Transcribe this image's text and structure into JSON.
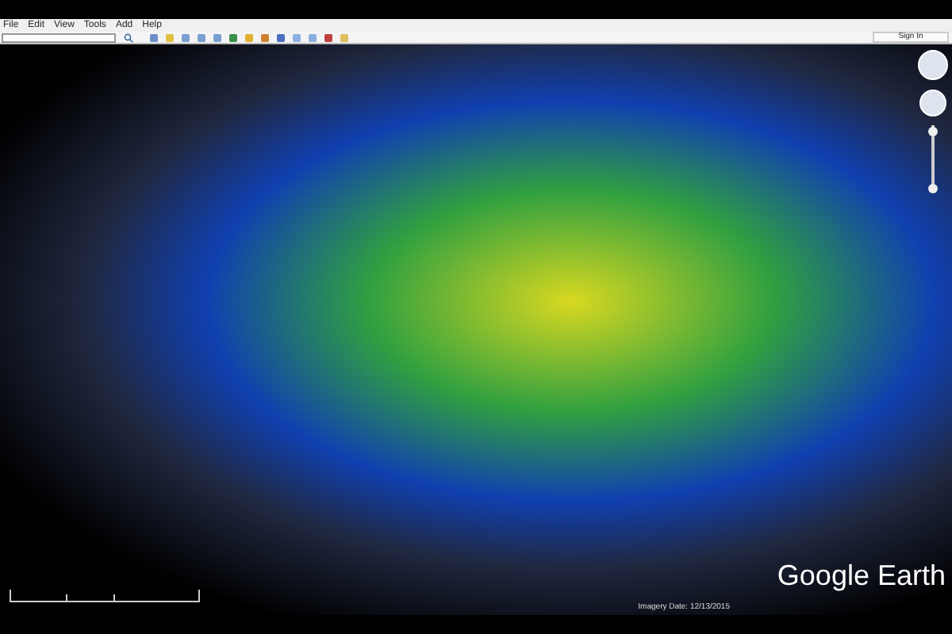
{
  "menu_bar": {
    "items": [
      "File",
      "Edit",
      "View",
      "Tools",
      "Add",
      "Help"
    ]
  },
  "toolbar": {
    "sign_in": "Sign In"
  },
  "map": {
    "logo": "Google Earth",
    "status": {
      "imagery_date": "Imagery Date: 12/13/2015"
    }
  }
}
